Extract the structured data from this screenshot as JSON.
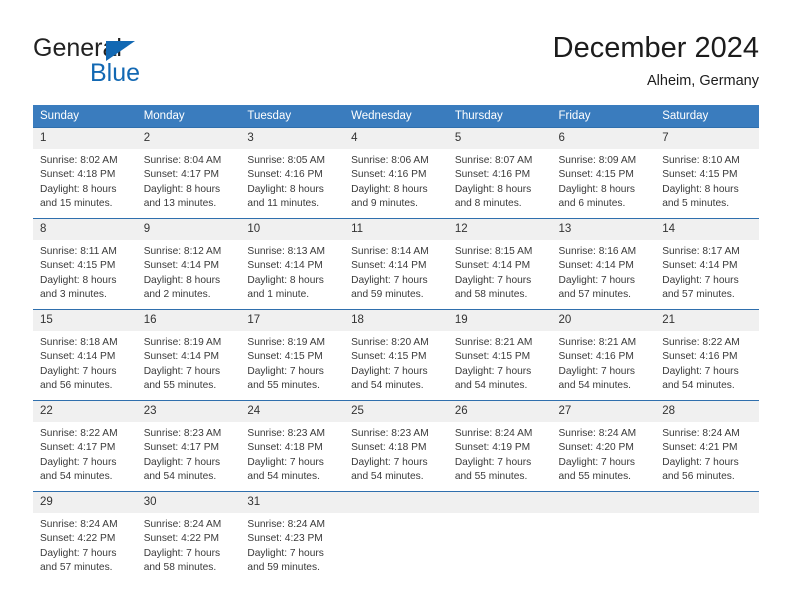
{
  "brand": {
    "name_part1": "General",
    "name_part2": "Blue",
    "logo_icon": "triangle-icon",
    "colors": {
      "blue": "#1268b3",
      "dark": "#222222"
    }
  },
  "header": {
    "title": "December 2024",
    "subtitle": "Alheim, Germany"
  },
  "colors": {
    "header_bar": "#3a7cbe",
    "row_divider": "#2f6fad",
    "daynum_bg": "#f0f0f0"
  },
  "calendar": {
    "weekday_headers": [
      "Sunday",
      "Monday",
      "Tuesday",
      "Wednesday",
      "Thursday",
      "Friday",
      "Saturday"
    ],
    "weeks": [
      [
        {
          "day": "1",
          "sunrise": "Sunrise: 8:02 AM",
          "sunset": "Sunset: 4:18 PM",
          "daylight_line1": "Daylight: 8 hours",
          "daylight_line2": "and 15 minutes."
        },
        {
          "day": "2",
          "sunrise": "Sunrise: 8:04 AM",
          "sunset": "Sunset: 4:17 PM",
          "daylight_line1": "Daylight: 8 hours",
          "daylight_line2": "and 13 minutes."
        },
        {
          "day": "3",
          "sunrise": "Sunrise: 8:05 AM",
          "sunset": "Sunset: 4:16 PM",
          "daylight_line1": "Daylight: 8 hours",
          "daylight_line2": "and 11 minutes."
        },
        {
          "day": "4",
          "sunrise": "Sunrise: 8:06 AM",
          "sunset": "Sunset: 4:16 PM",
          "daylight_line1": "Daylight: 8 hours",
          "daylight_line2": "and 9 minutes."
        },
        {
          "day": "5",
          "sunrise": "Sunrise: 8:07 AM",
          "sunset": "Sunset: 4:16 PM",
          "daylight_line1": "Daylight: 8 hours",
          "daylight_line2": "and 8 minutes."
        },
        {
          "day": "6",
          "sunrise": "Sunrise: 8:09 AM",
          "sunset": "Sunset: 4:15 PM",
          "daylight_line1": "Daylight: 8 hours",
          "daylight_line2": "and 6 minutes."
        },
        {
          "day": "7",
          "sunrise": "Sunrise: 8:10 AM",
          "sunset": "Sunset: 4:15 PM",
          "daylight_line1": "Daylight: 8 hours",
          "daylight_line2": "and 5 minutes."
        }
      ],
      [
        {
          "day": "8",
          "sunrise": "Sunrise: 8:11 AM",
          "sunset": "Sunset: 4:15 PM",
          "daylight_line1": "Daylight: 8 hours",
          "daylight_line2": "and 3 minutes."
        },
        {
          "day": "9",
          "sunrise": "Sunrise: 8:12 AM",
          "sunset": "Sunset: 4:14 PM",
          "daylight_line1": "Daylight: 8 hours",
          "daylight_line2": "and 2 minutes."
        },
        {
          "day": "10",
          "sunrise": "Sunrise: 8:13 AM",
          "sunset": "Sunset: 4:14 PM",
          "daylight_line1": "Daylight: 8 hours",
          "daylight_line2": "and 1 minute."
        },
        {
          "day": "11",
          "sunrise": "Sunrise: 8:14 AM",
          "sunset": "Sunset: 4:14 PM",
          "daylight_line1": "Daylight: 7 hours",
          "daylight_line2": "and 59 minutes."
        },
        {
          "day": "12",
          "sunrise": "Sunrise: 8:15 AM",
          "sunset": "Sunset: 4:14 PM",
          "daylight_line1": "Daylight: 7 hours",
          "daylight_line2": "and 58 minutes."
        },
        {
          "day": "13",
          "sunrise": "Sunrise: 8:16 AM",
          "sunset": "Sunset: 4:14 PM",
          "daylight_line1": "Daylight: 7 hours",
          "daylight_line2": "and 57 minutes."
        },
        {
          "day": "14",
          "sunrise": "Sunrise: 8:17 AM",
          "sunset": "Sunset: 4:14 PM",
          "daylight_line1": "Daylight: 7 hours",
          "daylight_line2": "and 57 minutes."
        }
      ],
      [
        {
          "day": "15",
          "sunrise": "Sunrise: 8:18 AM",
          "sunset": "Sunset: 4:14 PM",
          "daylight_line1": "Daylight: 7 hours",
          "daylight_line2": "and 56 minutes."
        },
        {
          "day": "16",
          "sunrise": "Sunrise: 8:19 AM",
          "sunset": "Sunset: 4:14 PM",
          "daylight_line1": "Daylight: 7 hours",
          "daylight_line2": "and 55 minutes."
        },
        {
          "day": "17",
          "sunrise": "Sunrise: 8:19 AM",
          "sunset": "Sunset: 4:15 PM",
          "daylight_line1": "Daylight: 7 hours",
          "daylight_line2": "and 55 minutes."
        },
        {
          "day": "18",
          "sunrise": "Sunrise: 8:20 AM",
          "sunset": "Sunset: 4:15 PM",
          "daylight_line1": "Daylight: 7 hours",
          "daylight_line2": "and 54 minutes."
        },
        {
          "day": "19",
          "sunrise": "Sunrise: 8:21 AM",
          "sunset": "Sunset: 4:15 PM",
          "daylight_line1": "Daylight: 7 hours",
          "daylight_line2": "and 54 minutes."
        },
        {
          "day": "20",
          "sunrise": "Sunrise: 8:21 AM",
          "sunset": "Sunset: 4:16 PM",
          "daylight_line1": "Daylight: 7 hours",
          "daylight_line2": "and 54 minutes."
        },
        {
          "day": "21",
          "sunrise": "Sunrise: 8:22 AM",
          "sunset": "Sunset: 4:16 PM",
          "daylight_line1": "Daylight: 7 hours",
          "daylight_line2": "and 54 minutes."
        }
      ],
      [
        {
          "day": "22",
          "sunrise": "Sunrise: 8:22 AM",
          "sunset": "Sunset: 4:17 PM",
          "daylight_line1": "Daylight: 7 hours",
          "daylight_line2": "and 54 minutes."
        },
        {
          "day": "23",
          "sunrise": "Sunrise: 8:23 AM",
          "sunset": "Sunset: 4:17 PM",
          "daylight_line1": "Daylight: 7 hours",
          "daylight_line2": "and 54 minutes."
        },
        {
          "day": "24",
          "sunrise": "Sunrise: 8:23 AM",
          "sunset": "Sunset: 4:18 PM",
          "daylight_line1": "Daylight: 7 hours",
          "daylight_line2": "and 54 minutes."
        },
        {
          "day": "25",
          "sunrise": "Sunrise: 8:23 AM",
          "sunset": "Sunset: 4:18 PM",
          "daylight_line1": "Daylight: 7 hours",
          "daylight_line2": "and 54 minutes."
        },
        {
          "day": "26",
          "sunrise": "Sunrise: 8:24 AM",
          "sunset": "Sunset: 4:19 PM",
          "daylight_line1": "Daylight: 7 hours",
          "daylight_line2": "and 55 minutes."
        },
        {
          "day": "27",
          "sunrise": "Sunrise: 8:24 AM",
          "sunset": "Sunset: 4:20 PM",
          "daylight_line1": "Daylight: 7 hours",
          "daylight_line2": "and 55 minutes."
        },
        {
          "day": "28",
          "sunrise": "Sunrise: 8:24 AM",
          "sunset": "Sunset: 4:21 PM",
          "daylight_line1": "Daylight: 7 hours",
          "daylight_line2": "and 56 minutes."
        }
      ],
      [
        {
          "day": "29",
          "sunrise": "Sunrise: 8:24 AM",
          "sunset": "Sunset: 4:22 PM",
          "daylight_line1": "Daylight: 7 hours",
          "daylight_line2": "and 57 minutes."
        },
        {
          "day": "30",
          "sunrise": "Sunrise: 8:24 AM",
          "sunset": "Sunset: 4:22 PM",
          "daylight_line1": "Daylight: 7 hours",
          "daylight_line2": "and 58 minutes."
        },
        {
          "day": "31",
          "sunrise": "Sunrise: 8:24 AM",
          "sunset": "Sunset: 4:23 PM",
          "daylight_line1": "Daylight: 7 hours",
          "daylight_line2": "and 59 minutes."
        },
        {
          "day": "",
          "sunrise": "",
          "sunset": "",
          "daylight_line1": "",
          "daylight_line2": ""
        },
        {
          "day": "",
          "sunrise": "",
          "sunset": "",
          "daylight_line1": "",
          "daylight_line2": ""
        },
        {
          "day": "",
          "sunrise": "",
          "sunset": "",
          "daylight_line1": "",
          "daylight_line2": ""
        },
        {
          "day": "",
          "sunrise": "",
          "sunset": "",
          "daylight_line1": "",
          "daylight_line2": ""
        }
      ]
    ]
  }
}
